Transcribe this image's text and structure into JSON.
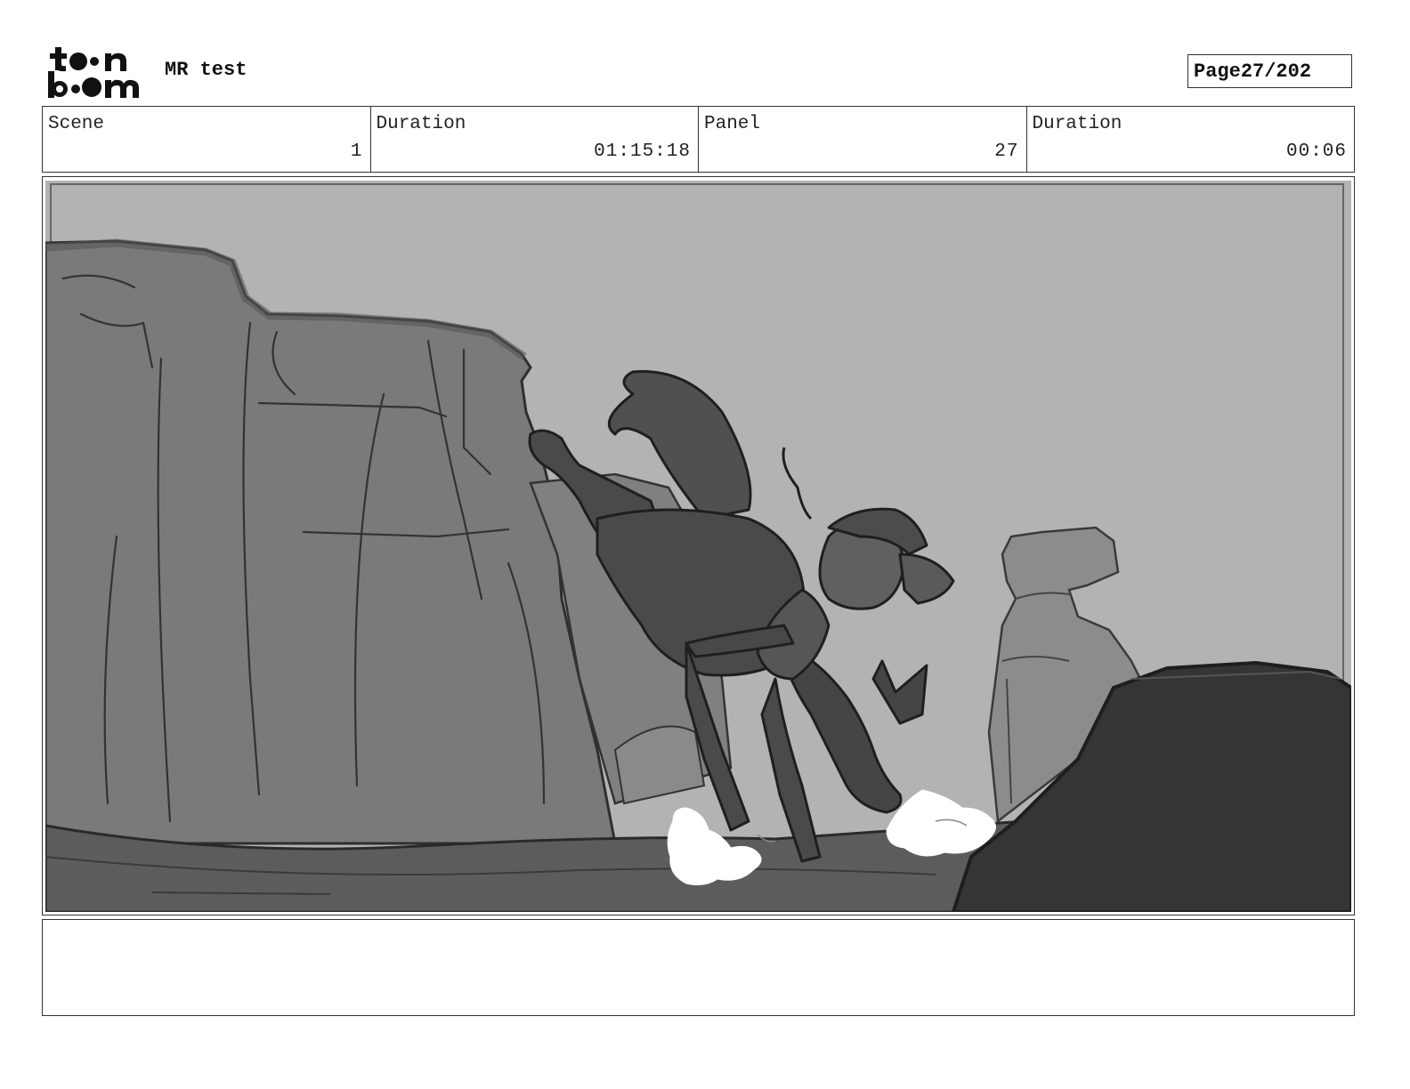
{
  "header": {
    "logo_text": "toon boom",
    "project_title": "MR test",
    "page_label": "Page",
    "page_number": "27/202"
  },
  "info": {
    "scene_label": "Scene",
    "scene_value": "1",
    "scene_duration_label": "Duration",
    "scene_duration_value": "01:15:18",
    "panel_label": "Panel",
    "panel_value": "27",
    "panel_duration_label": "Duration",
    "panel_duration_value": "00:06"
  },
  "notes": {
    "text": ""
  }
}
